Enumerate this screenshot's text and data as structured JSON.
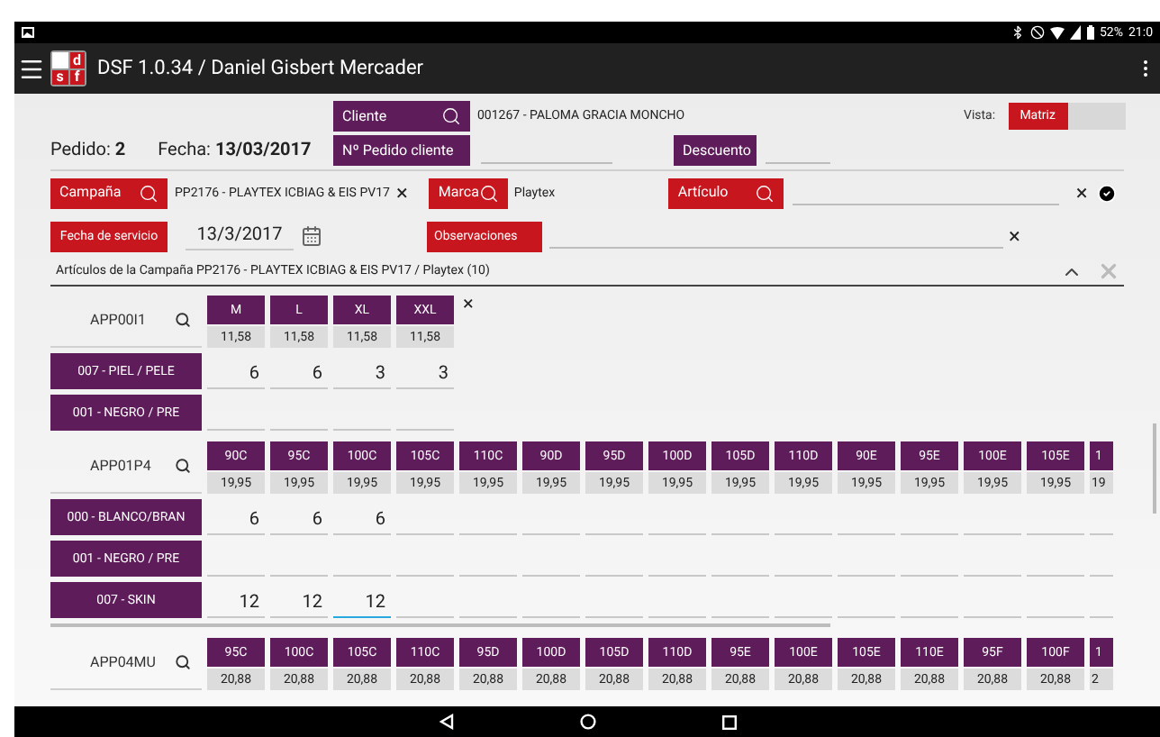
{
  "status_bar": {
    "battery": "52%",
    "time": "21:0"
  },
  "app_bar": {
    "logo": [
      "d",
      "s",
      "f"
    ],
    "title": "DSF 1.0.34 / Daniel Gisbert Mercader"
  },
  "order": {
    "pedido_label": "Pedido:",
    "pedido": "2",
    "fecha_label": "Fecha:",
    "fecha": "13/03/2017",
    "cliente_button": "Cliente",
    "cliente": "001267 - PALOMA GRACIA MONCHO",
    "pedido_cliente_button": "Nº Pedido cliente",
    "descuento_button": "Descuento",
    "vista_label": "Vista:",
    "vista_toggle": {
      "label": "Matriz",
      "on": true
    }
  },
  "filters": {
    "campana_button": "Campaña",
    "campana": "PP2176 - PLAYTEX ICBIAG & EIS PV17",
    "clear": "×",
    "marca_button": "Marca",
    "marca": "Playtex",
    "articulo_button": "Artículo",
    "articulo_clear": "×",
    "fecha_servicio_button": "Fecha de servicio",
    "fecha_servicio": "13/3/2017",
    "observaciones_button": "Observaciones",
    "observaciones_clear": "×"
  },
  "section_title": "Artículos de la Campaña PP2176 - PLAYTEX ICBIAG & EIS PV17 / Playtex (10)",
  "matrices": [
    {
      "code": "APP00I1",
      "cut_off": false,
      "remove": "×",
      "sizes": [
        {
          "label": "M",
          "price": "11,58"
        },
        {
          "label": "L",
          "price": "11,58"
        },
        {
          "label": "XL",
          "price": "11,58"
        },
        {
          "label": "XXL",
          "price": "11,58"
        }
      ],
      "rows": [
        {
          "label": "007 - PIEL / PELE",
          "values": [
            {
              "value": "6",
              "focused": false
            },
            {
              "value": "6",
              "focused": false
            },
            {
              "value": "3",
              "focused": false
            },
            {
              "value": "3",
              "focused": false
            }
          ]
        },
        {
          "label": "001 - NEGRO / PRE",
          "values": []
        }
      ]
    },
    {
      "code": "APP01P4",
      "cut_off": true,
      "sizes": [
        {
          "label": "90C",
          "price": "19,95"
        },
        {
          "label": "95C",
          "price": "19,95"
        },
        {
          "label": "100C",
          "price": "19,95"
        },
        {
          "label": "105C",
          "price": "19,95"
        },
        {
          "label": "110C",
          "price": "19,95"
        },
        {
          "label": "90D",
          "price": "19,95"
        },
        {
          "label": "95D",
          "price": "19,95"
        },
        {
          "label": "100D",
          "price": "19,95"
        },
        {
          "label": "105D",
          "price": "19,95"
        },
        {
          "label": "110D",
          "price": "19,95"
        },
        {
          "label": "90E",
          "price": "19,95"
        },
        {
          "label": "95E",
          "price": "19,95"
        },
        {
          "label": "100E",
          "price": "19,95"
        },
        {
          "label": "105E",
          "price": "19,95"
        },
        {
          "label": "1",
          "price": "19"
        }
      ],
      "rows": [
        {
          "label": "000 - BLANCO/BRAN",
          "values": [
            {
              "value": "6",
              "focused": false
            },
            {
              "value": "6",
              "focused": false
            },
            {
              "value": "6",
              "focused": false
            }
          ]
        },
        {
          "label": "001 - NEGRO / PRE",
          "values": []
        },
        {
          "label": "007 - SKIN",
          "values": [
            {
              "value": "12",
              "focused": false
            },
            {
              "value": "12",
              "focused": false
            },
            {
              "value": "12",
              "focused": true
            }
          ]
        }
      ]
    },
    {
      "code": "APP04MU",
      "cut_off": true,
      "sizes": [
        {
          "label": "95C",
          "price": "20,88"
        },
        {
          "label": "100C",
          "price": "20,88"
        },
        {
          "label": "105C",
          "price": "20,88"
        },
        {
          "label": "110C",
          "price": "20,88"
        },
        {
          "label": "95D",
          "price": "20,88"
        },
        {
          "label": "100D",
          "price": "20,88"
        },
        {
          "label": "105D",
          "price": "20,88"
        },
        {
          "label": "110D",
          "price": "20,88"
        },
        {
          "label": "95E",
          "price": "20,88"
        },
        {
          "label": "100E",
          "price": "20,88"
        },
        {
          "label": "105E",
          "price": "20,88"
        },
        {
          "label": "110E",
          "price": "20,88"
        },
        {
          "label": "95F",
          "price": "20,88"
        },
        {
          "label": "100F",
          "price": "20,88"
        },
        {
          "label": "1",
          "price": "2"
        }
      ]
    }
  ]
}
